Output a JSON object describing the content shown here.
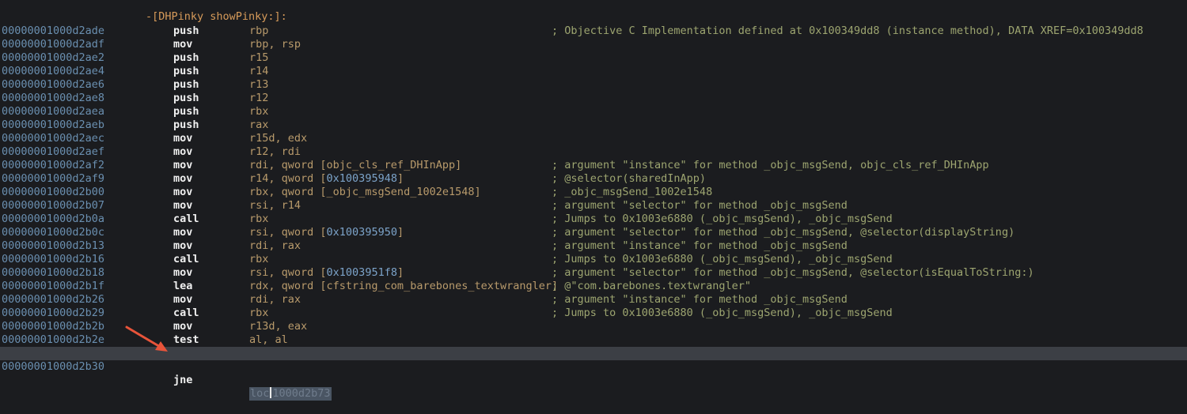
{
  "procedure": {
    "header": "-[DHPinky showPinky:]:"
  },
  "rows": [
    {
      "addr": "00000001000d2ade",
      "mnem": "push",
      "ops": "rbp",
      "comment": "; Objective C Implementation defined at 0x100349dd8 (instance method), DATA XREF=0x100349dd8"
    },
    {
      "addr": "00000001000d2adf",
      "mnem": "mov",
      "ops": "rbp, rsp",
      "comment": ""
    },
    {
      "addr": "00000001000d2ae2",
      "mnem": "push",
      "ops": "r15",
      "comment": ""
    },
    {
      "addr": "00000001000d2ae4",
      "mnem": "push",
      "ops": "r14",
      "comment": ""
    },
    {
      "addr": "00000001000d2ae6",
      "mnem": "push",
      "ops": "r13",
      "comment": ""
    },
    {
      "addr": "00000001000d2ae8",
      "mnem": "push",
      "ops": "r12",
      "comment": ""
    },
    {
      "addr": "00000001000d2aea",
      "mnem": "push",
      "ops": "rbx",
      "comment": ""
    },
    {
      "addr": "00000001000d2aeb",
      "mnem": "push",
      "ops": "rax",
      "comment": ""
    },
    {
      "addr": "00000001000d2aec",
      "mnem": "mov",
      "ops": "r15d, edx",
      "comment": ""
    },
    {
      "addr": "00000001000d2aef",
      "mnem": "mov",
      "ops": "r12, rdi",
      "comment": ""
    },
    {
      "addr": "00000001000d2af2",
      "mnem": "mov",
      "ops": "rdi, qword [objc_cls_ref_DHInApp]",
      "comment": "; argument \"instance\" for method _objc_msgSend, objc_cls_ref_DHInApp"
    },
    {
      "addr": "00000001000d2af9",
      "mnem": "mov",
      "ops": "r14, qword [0x100395948]",
      "comment": "; @selector(sharedInApp)"
    },
    {
      "addr": "00000001000d2b00",
      "mnem": "mov",
      "ops": "rbx, qword [_objc_msgSend_1002e1548]",
      "comment": "; _objc_msgSend_1002e1548"
    },
    {
      "addr": "00000001000d2b07",
      "mnem": "mov",
      "ops": "rsi, r14",
      "comment": "; argument \"selector\" for method _objc_msgSend"
    },
    {
      "addr": "00000001000d2b0a",
      "mnem": "call",
      "ops": "rbx",
      "comment": "; Jumps to 0x1003e6880 (_objc_msgSend), _objc_msgSend"
    },
    {
      "addr": "00000001000d2b0c",
      "mnem": "mov",
      "ops": "rsi, qword [0x100395950]",
      "comment": "; argument \"selector\" for method _objc_msgSend, @selector(displayString)"
    },
    {
      "addr": "00000001000d2b13",
      "mnem": "mov",
      "ops": "rdi, rax",
      "comment": "; argument \"instance\" for method _objc_msgSend"
    },
    {
      "addr": "00000001000d2b16",
      "mnem": "call",
      "ops": "rbx",
      "comment": "; Jumps to 0x1003e6880 (_objc_msgSend), _objc_msgSend"
    },
    {
      "addr": "00000001000d2b18",
      "mnem": "mov",
      "ops": "rsi, qword [0x1003951f8]",
      "comment": "; argument \"selector\" for method _objc_msgSend, @selector(isEqualToString:)"
    },
    {
      "addr": "00000001000d2b1f",
      "mnem": "lea",
      "ops": "rdx, qword [cfstring_com_barebones_textwrangler]",
      "comment": "; @\"com.barebones.textwrangler\""
    },
    {
      "addr": "00000001000d2b26",
      "mnem": "mov",
      "ops": "rdi, rax",
      "comment": "; argument \"instance\" for method _objc_msgSend"
    },
    {
      "addr": "00000001000d2b29",
      "mnem": "call",
      "ops": "rbx",
      "comment": "; Jumps to 0x1003e6880 (_objc_msgSend), _objc_msgSend"
    },
    {
      "addr": "00000001000d2b2b",
      "mnem": "mov",
      "ops": "r13d, eax",
      "comment": ""
    },
    {
      "addr": "00000001000d2b2e",
      "mnem": "test",
      "ops": "al, al",
      "comment": ""
    }
  ],
  "current_row": {
    "addr": "00000001000d2b30",
    "mnem": "jne",
    "target_prefix": "loc",
    "target_address": "1000d2b73"
  },
  "colors": {
    "background": "#1b1c1f",
    "address": "#6a8fb0",
    "mnemonic": "#f0f0f0",
    "operand": "#b89a6b",
    "comment": "#9da570",
    "procedure_label": "#d79b5a",
    "current_line": "#3c3f45",
    "annotation_arrow": "#e8543a"
  },
  "annotation": {
    "icon": "red-arrow-icon"
  }
}
